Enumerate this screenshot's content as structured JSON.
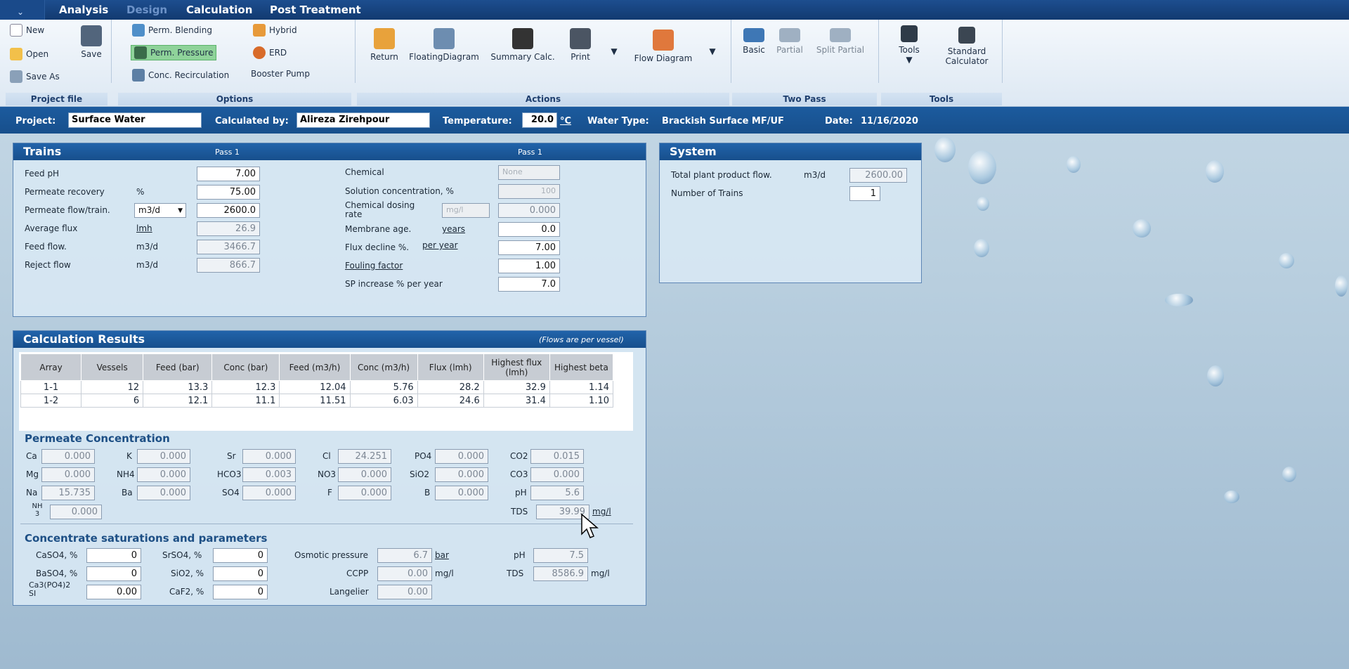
{
  "menu": [
    "Analysis",
    "Design",
    "Calculation",
    "Post Treatment"
  ],
  "ribbon": {
    "project_file": {
      "new": "New",
      "open": "Open",
      "save_as": "Save As",
      "save": "Save",
      "label": "Project file"
    },
    "options": {
      "perm_blending": "Perm. Blending",
      "perm_pressure": "Perm. Pressure",
      "conc_recirc": "Conc. Recirculation",
      "hybrid": "Hybrid",
      "erd": "ERD",
      "booster": "Booster Pump",
      "label": "Options"
    },
    "actions": {
      "return": "Return",
      "floating": "FloatingDiagram",
      "summary": "Summary Calc.",
      "print": "Print",
      "flow": "Flow Diagram",
      "label": "Actions"
    },
    "two_pass": {
      "basic": "Basic",
      "partial": "Partial",
      "split": "Split Partial",
      "label": "Two Pass"
    },
    "tools": {
      "tools": "Tools",
      "std_calc_1": "Standard",
      "std_calc_2": "Calculator",
      "label": "Tools"
    }
  },
  "project": {
    "project_label": "Project:",
    "project": "Surface Water",
    "calc_label": "Calculated by:",
    "calc_by": "Alireza Zirehpour",
    "temp_label": "Temperature:",
    "temp": "20.0",
    "temp_unit": "°C",
    "water_label": "Water Type:",
    "water": "Brackish Surface MF/UF",
    "date_label": "Date:",
    "date": "11/16/2020"
  },
  "trains": {
    "title": "Trains",
    "pass1": "Pass 1",
    "pass1b": "Pass 1",
    "feed_ph": {
      "label": "Feed pH",
      "value": "7.00"
    },
    "perm_recovery": {
      "label": "Permeate recovery",
      "unit": "%",
      "value": "75.00"
    },
    "perm_flow": {
      "label": "Permeate flow/train.",
      "unit": "m3/d",
      "value": "2600.0"
    },
    "avg_flux": {
      "label": "Average flux",
      "unit": "lmh",
      "value": "26.9"
    },
    "feed_flow": {
      "label": "Feed flow.",
      "unit": "m3/d",
      "value": "3466.7"
    },
    "reject_flow": {
      "label": "Reject flow",
      "unit": "m3/d",
      "value": "866.7"
    },
    "chemical": {
      "label": "Chemical",
      "value": "None"
    },
    "sol_conc": {
      "label": "Solution concentration, %",
      "value": "100"
    },
    "dosing": {
      "label1": "Chemical dosing",
      "label2": "rate",
      "unit": "mg/l",
      "value": "0.000"
    },
    "mem_age": {
      "label": "Membrane age.",
      "unit": "years",
      "value": "0.0"
    },
    "flux_decline": {
      "label": "Flux decline %.",
      "unit": "per year",
      "value": "7.00"
    },
    "fouling": {
      "label": "Fouling factor",
      "value": "1.00"
    },
    "sp_increase": {
      "label": "SP increase % per year",
      "value": "7.0"
    }
  },
  "system": {
    "title": "System",
    "total_flow": {
      "label": "Total plant product flow.",
      "unit": "m3/d",
      "value": "2600.00"
    },
    "num_trains": {
      "label": "Number of Trains",
      "value": "1"
    }
  },
  "results": {
    "title": "Calculation Results",
    "note": "(Flows are per vessel)",
    "headers": [
      "Array",
      "Vessels",
      "Feed (bar)",
      "Conc (bar)",
      "Feed (m3/h)",
      "Conc (m3/h)",
      "Flux (lmh)",
      "Highest flux (lmh)",
      "Highest beta"
    ],
    "rows": [
      [
        "1-1",
        "12",
        "13.3",
        "12.3",
        "12.04",
        "5.76",
        "28.2",
        "32.9",
        "1.14"
      ],
      [
        "1-2",
        "6",
        "12.1",
        "11.1",
        "11.51",
        "6.03",
        "24.6",
        "31.4",
        "1.10"
      ]
    ]
  },
  "permeate": {
    "title": "Permeate Concentration",
    "ions": [
      [
        "Ca",
        "0.000"
      ],
      [
        "K",
        "0.000"
      ],
      [
        "Sr",
        "0.000"
      ],
      [
        "Cl",
        "24.251"
      ],
      [
        "PO4",
        "0.000"
      ],
      [
        "CO2",
        "0.015"
      ],
      [
        "Mg",
        "0.000"
      ],
      [
        "NH4",
        "0.000"
      ],
      [
        "HCO3",
        "0.003"
      ],
      [
        "NO3",
        "0.000"
      ],
      [
        "SiO2",
        "0.000"
      ],
      [
        "CO3",
        "0.000"
      ],
      [
        "Na",
        "15.735"
      ],
      [
        "Ba",
        "0.000"
      ],
      [
        "SO4",
        "0.000"
      ],
      [
        "F",
        "0.000"
      ],
      [
        "B",
        "0.000"
      ],
      [
        "pH",
        "5.6"
      ]
    ],
    "nh3_label": "NH 3",
    "nh3": "0.000",
    "tds_label": "TDS",
    "tds": "39.99",
    "tds_unit": "mg/l"
  },
  "concentrate": {
    "title": "Concentrate saturations and parameters",
    "caso4": {
      "label": "CaSO4, %",
      "value": "0"
    },
    "baso4": {
      "label": "BaSO4, %",
      "value": "0"
    },
    "ca3po4": {
      "label": "Ca3(PO4)2 SI",
      "value": "0.00"
    },
    "srso4": {
      "label": "SrSO4, %",
      "value": "0"
    },
    "sio2": {
      "label": "SiO2, %",
      "value": "0"
    },
    "caf2": {
      "label": "CaF2, %",
      "value": "0"
    },
    "osm": {
      "label": "Osmotic pressure",
      "value": "6.7",
      "unit": "bar"
    },
    "ccpp": {
      "label": "CCPP",
      "value": "0.00",
      "unit": "mg/l"
    },
    "langelier": {
      "label": "Langelier",
      "value": "0.00"
    },
    "ph": {
      "label": "pH",
      "value": "7.5"
    },
    "tds": {
      "label": "TDS",
      "value": "8586.9",
      "unit": "mg/l"
    }
  },
  "colors": {
    "menu": "#123a70",
    "panel_header": "#1d5aa0",
    "selected": "#8fd39a"
  }
}
